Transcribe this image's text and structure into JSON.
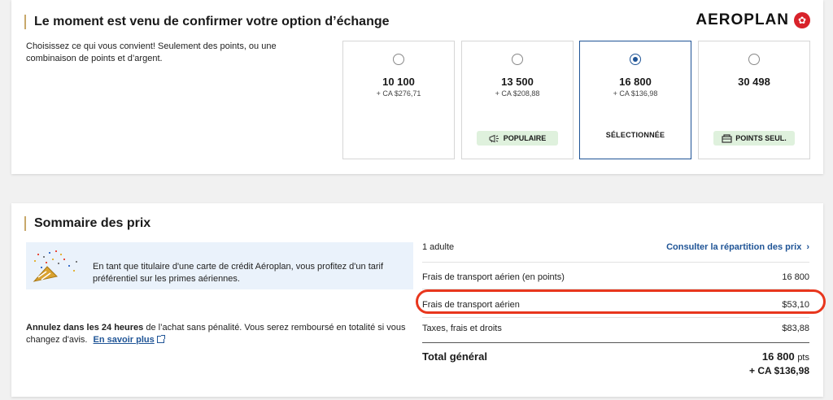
{
  "redemption": {
    "title": "Le moment est venu de confirmer votre option d’échange",
    "brand": "AEROPLAN",
    "brand_icon": "maple-leaf-icon",
    "intro": "Choisissez ce qui vous convient! Seulement des points, ou une combinaison de points et d’argent.",
    "options": [
      {
        "points": "10 100",
        "cash": "+ CA $276,71",
        "selected": false,
        "tag": ""
      },
      {
        "points": "13 500",
        "cash": "+ CA $208,88",
        "selected": false,
        "tag": "POPULAIRE",
        "tag_icon": "megaphone-icon"
      },
      {
        "points": "16 800",
        "cash": "+ CA $136,98",
        "selected": true,
        "tag": "SÉLECTIONNÉE"
      },
      {
        "points": "30 498",
        "cash": "",
        "selected": false,
        "tag": "POINTS SEUL.",
        "tag_icon": "wallet-icon"
      }
    ]
  },
  "summary": {
    "title": "Sommaire des prix",
    "notice": "En tant que titulaire d'une carte de crédit Aéroplan, vous profitez d'un tarif préférentiel sur les primes aériennes.",
    "cancel_bold": "Annulez dans les 24 heures",
    "cancel_text": " de l’achat sans pénalité. Vous serez remboursé en totalité si vous changez d'avis.",
    "learn_more": "En savoir plus",
    "passengers": "1 adulte",
    "breakdown_link": "Consulter la répartition des prix",
    "rows": {
      "points_label": "Frais de transport aérien (en points)",
      "points_value": "16 800",
      "air_label": "Frais de transport aérien",
      "air_value": "$53,10",
      "tax_label": "Taxes, frais et droits",
      "tax_value": "$83,88"
    },
    "total_label": "Total général",
    "total_points": "16 800",
    "total_points_unit": "pts",
    "total_cash": "+ CA $136,98"
  },
  "colors": {
    "accent": "#1f5496",
    "brand_red": "#d8222a",
    "highlight": "#e8361d",
    "tag_bg": "#dff1dd",
    "notice_bg": "#eaf2fb"
  }
}
